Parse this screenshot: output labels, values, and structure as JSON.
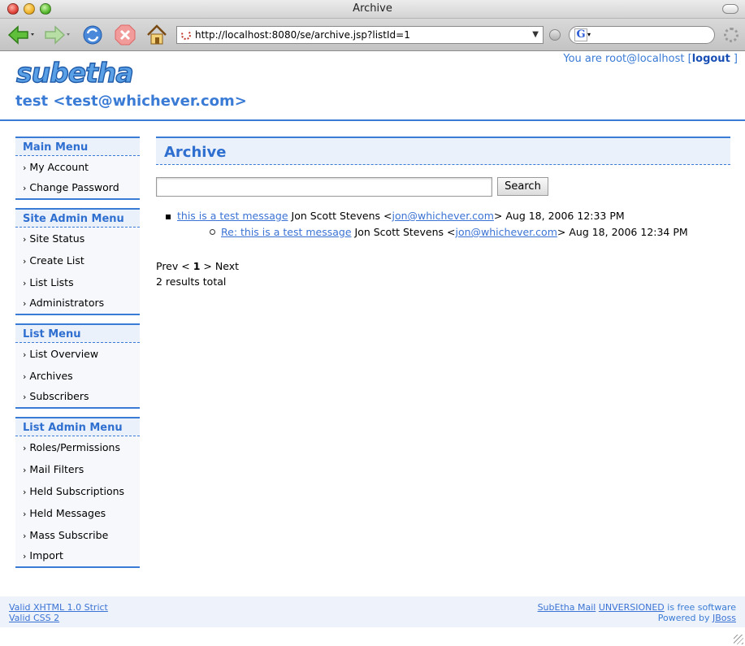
{
  "window": {
    "title": "Archive"
  },
  "browser": {
    "url": "http://localhost:8080/se/archive.jsp?listId=1",
    "search_value": "",
    "search_engine_icon": "google-icon"
  },
  "header": {
    "logo_text": "subetha",
    "list_title": "test <test@whichever.com>",
    "user_prefix": "You are root@localhost [",
    "logout_label": "logout",
    "user_suffix": " ]"
  },
  "sidebar": {
    "menus": [
      {
        "title": "Main Menu",
        "items": [
          "My Account",
          "Change Password"
        ]
      },
      {
        "title": "Site Admin Menu",
        "items": [
          "Site Status",
          "Create List",
          "List Lists",
          "Administrators"
        ]
      },
      {
        "title": "List Menu",
        "items": [
          "List Overview",
          "Archives",
          "Subscribers"
        ]
      },
      {
        "title": "List Admin Menu",
        "items": [
          "Roles/Permissions",
          "Mail Filters",
          "Held Subscriptions",
          "Held Messages",
          "Mass Subscribe",
          "Import"
        ]
      }
    ]
  },
  "main": {
    "heading": "Archive",
    "search_value": "",
    "search_button": "Search",
    "messages": [
      {
        "subject": "this is a test message",
        "author": "Jon Scott Stevens",
        "email": "jon@whichever.com",
        "date": "Aug 18, 2006 12:33 PM"
      },
      {
        "subject": "Re: this is a test message",
        "author": "Jon Scott Stevens",
        "email": "jon@whichever.com",
        "date": "Aug 18, 2006 12:34 PM"
      }
    ],
    "pager": {
      "prev": "Prev",
      "lt": "<",
      "current": "1",
      "gt": ">",
      "next": "Next"
    },
    "results_total": "2 results total"
  },
  "footer": {
    "xhtml": "Valid XHTML 1.0 Strict",
    "css": "Valid CSS 2",
    "product": "SubEtha Mail",
    "version": "UNVERSIONED",
    "free_text": " is free software",
    "powered": "Powered by ",
    "jboss": "JBoss"
  },
  "colors": {
    "accent": "#3a7bd5",
    "menu_bg": "#eaf1fb",
    "link": "#3b73d4"
  }
}
